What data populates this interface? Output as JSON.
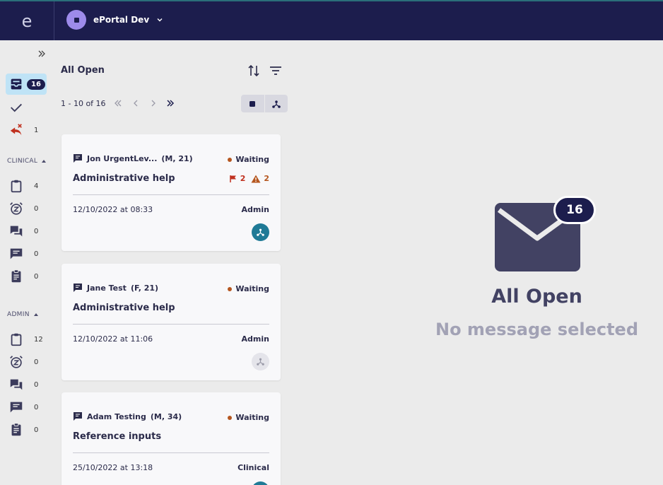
{
  "app": {
    "logo": "e",
    "org_name": "ePortal Dev"
  },
  "sidebar": {
    "top_items": [
      {
        "icon": "inbox-icon",
        "badge": "16"
      },
      {
        "icon": "checkmark-icon",
        "count": ""
      },
      {
        "icon": "reply-rejected-icon",
        "count": "1"
      }
    ],
    "clinical": {
      "label": "CLINICAL",
      "items": [
        {
          "icon": "clipboard-icon",
          "count": "4"
        },
        {
          "icon": "snooze-alarm-icon",
          "count": "0"
        },
        {
          "icon": "conversation-icon",
          "count": "0"
        },
        {
          "icon": "message-icon",
          "count": "0"
        },
        {
          "icon": "assignment-icon",
          "count": "0"
        }
      ]
    },
    "admin": {
      "label": "ADMIN",
      "items": [
        {
          "icon": "clipboard-icon",
          "count": "12"
        },
        {
          "icon": "snooze-alarm-icon",
          "count": "0"
        },
        {
          "icon": "conversation-icon",
          "count": "0"
        },
        {
          "icon": "message-icon",
          "count": "0"
        },
        {
          "icon": "assignment-icon",
          "count": "0"
        }
      ]
    }
  },
  "list": {
    "title": "All Open",
    "pager": "1 - 10 of 16",
    "cards": [
      {
        "patient": "Jon UrgentLev...",
        "demographics": "(M, 21)",
        "status": "Waiting",
        "subject": "Administrative help",
        "flag_count": "2",
        "warning_count": "2",
        "date": "12/10/2022 at 08:33",
        "role": "Admin"
      },
      {
        "patient": "Jane Test",
        "demographics": "(F, 21)",
        "status": "Waiting",
        "subject": "Administrative help",
        "date": "12/10/2022 at 11:06",
        "role": "Admin"
      },
      {
        "patient": "Adam Testing",
        "demographics": "(M, 34)",
        "status": "Waiting",
        "subject": "Reference inputs",
        "date": "25/10/2022 at 13:18",
        "role": "Clinical"
      }
    ]
  },
  "detail": {
    "badge": "16",
    "title": "All Open",
    "subtitle": "No message selected"
  },
  "colors": {
    "navy": "#1c1d4d",
    "teal": "#1f7a96",
    "status_dot": "#b5561f",
    "flag_red": "#c0311f",
    "warning_orange": "#b5561f",
    "active_bg": "#bfe3f6"
  }
}
